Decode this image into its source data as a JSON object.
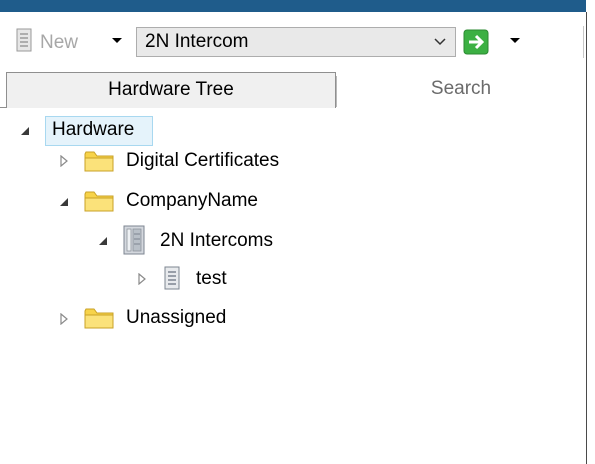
{
  "toolbar": {
    "new_label": "New",
    "new_icon": "new-document-icon",
    "hardware_combo_value": "2N Intercom",
    "go_icon": "green-arrow-right-icon",
    "accent_green": "#3cb043"
  },
  "tabs": [
    {
      "label": "Hardware Tree",
      "selected": true
    },
    {
      "label": "Search",
      "selected": false
    }
  ],
  "tree": {
    "root": {
      "label": "Hardware",
      "expanded": true,
      "selected": true
    },
    "digital_certificates": {
      "label": "Digital Certificates",
      "expanded": false,
      "icon": "folder-icon"
    },
    "company": {
      "label": "CompanyName",
      "expanded": true,
      "icon": "folder-icon"
    },
    "intercoms": {
      "label": "2N Intercoms",
      "expanded": true,
      "icon": "server-icon"
    },
    "test": {
      "label": "test",
      "expanded": false,
      "icon": "document-icon"
    },
    "unassigned": {
      "label": "Unassigned",
      "expanded": false,
      "icon": "folder-icon"
    }
  },
  "colors": {
    "title_bar": "#1f5c8b",
    "selection_fill": "#e5f3fb",
    "selection_border": "#a8d8f0",
    "folder_yellow": "#f7d34a"
  }
}
